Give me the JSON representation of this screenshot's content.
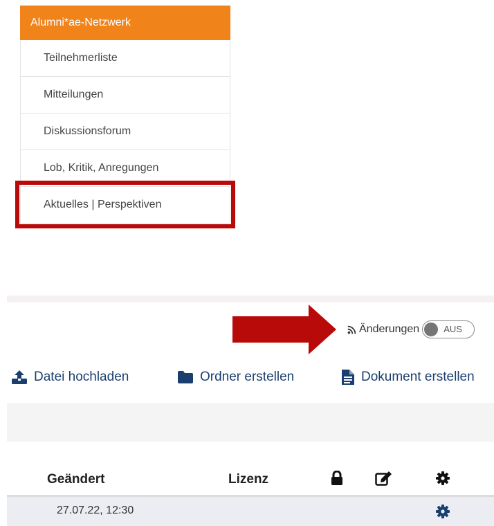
{
  "nav": {
    "header": "Alumni*ae-Netzwerk",
    "items": [
      {
        "label": "Teilnehmerliste"
      },
      {
        "label": "Mitteilungen"
      },
      {
        "label": "Diskussionsforum"
      },
      {
        "label": "Lob, Kritik, Anregungen"
      },
      {
        "label": "Aktuelles | Perspektiven"
      }
    ],
    "highlight_color": "#b90a0a",
    "header_color": "#f0841a"
  },
  "changes": {
    "label": "Änderungen",
    "toggle_state": "AUS",
    "icon": "rss-icon"
  },
  "actions": {
    "upload": {
      "label": "Datei hochladen",
      "icon": "upload-icon"
    },
    "folder": {
      "label": "Ordner erstellen",
      "icon": "folder-icon"
    },
    "document": {
      "label": "Dokument erstellen",
      "icon": "file-text-icon"
    }
  },
  "table": {
    "columns": {
      "changed": "Geändert",
      "license": "Lizenz",
      "lock": "lock-icon",
      "edit": "edit-icon",
      "settings": "gear-icon"
    },
    "rows": [
      {
        "changed": "27.07.22, 12:30",
        "license": ""
      }
    ]
  },
  "accent_color": "#1a3f6e"
}
